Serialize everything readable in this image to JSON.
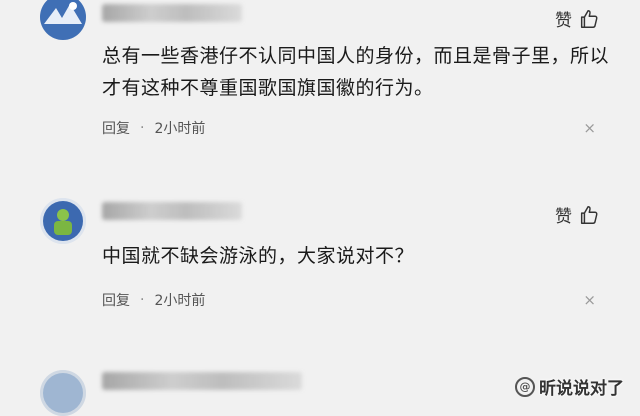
{
  "comments": [
    {
      "like_label": "赞",
      "text": "总有一些香港仔不认同中国人的身份，而且是骨子里，所以才有这种不尊重国歌国旗国徽的行为。",
      "reply_label": "回复",
      "time": "2小时前",
      "close": "×"
    },
    {
      "like_label": "赞",
      "text": "中国就不缺会游泳的，大家说对不？",
      "reply_label": "回复",
      "time": "2小时前",
      "close": "×"
    },
    {
      "like_label": ""
    }
  ],
  "meta_separator": "·",
  "watermark": {
    "symbol": "@",
    "text": "昕说说对了"
  }
}
